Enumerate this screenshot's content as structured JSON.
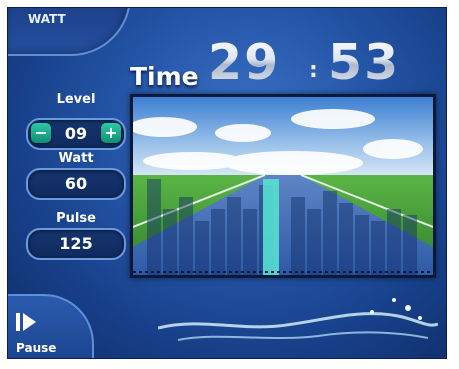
{
  "mode": {
    "label": "WATT"
  },
  "timer": {
    "label": "Time",
    "minutes": "29",
    "separator": ":",
    "seconds": "53"
  },
  "level": {
    "label": "Level",
    "value": "09",
    "decrease_symbol": "−",
    "increase_symbol": "+"
  },
  "watt": {
    "label": "Watt",
    "value": "60"
  },
  "pulse": {
    "label": "Pulse",
    "value": "125"
  },
  "pause": {
    "label": "Pause",
    "icon": "play-pause-icon"
  },
  "progress": {
    "current_fraction": 0.46
  },
  "colors": {
    "background": "#2454a6",
    "accent": "#2cc9a6",
    "road": "#3f6fb8",
    "grass": "#3c9a36"
  }
}
